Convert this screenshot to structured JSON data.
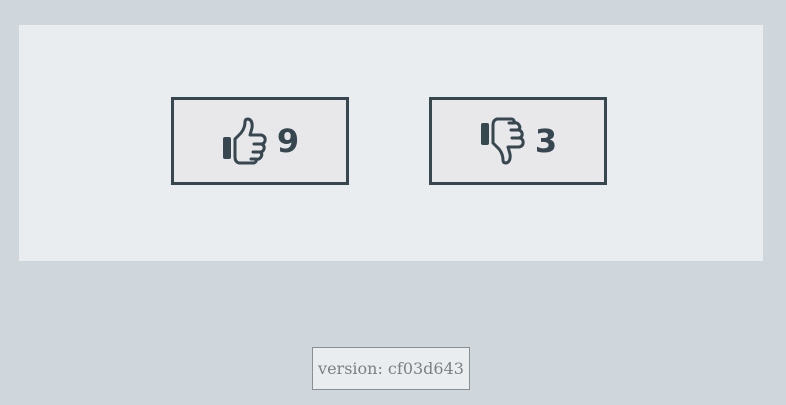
{
  "votes": {
    "upvote": {
      "icon": "thumbs-up-icon",
      "count": "9"
    },
    "downvote": {
      "icon": "thumbs-down-icon",
      "count": "3"
    }
  },
  "footer": {
    "version_label": "version: cf03d643"
  },
  "colors": {
    "background": "#d0d7dc",
    "panel": "#e9edf0",
    "button_bg": "#e8e7ea",
    "accent": "#36474f"
  }
}
